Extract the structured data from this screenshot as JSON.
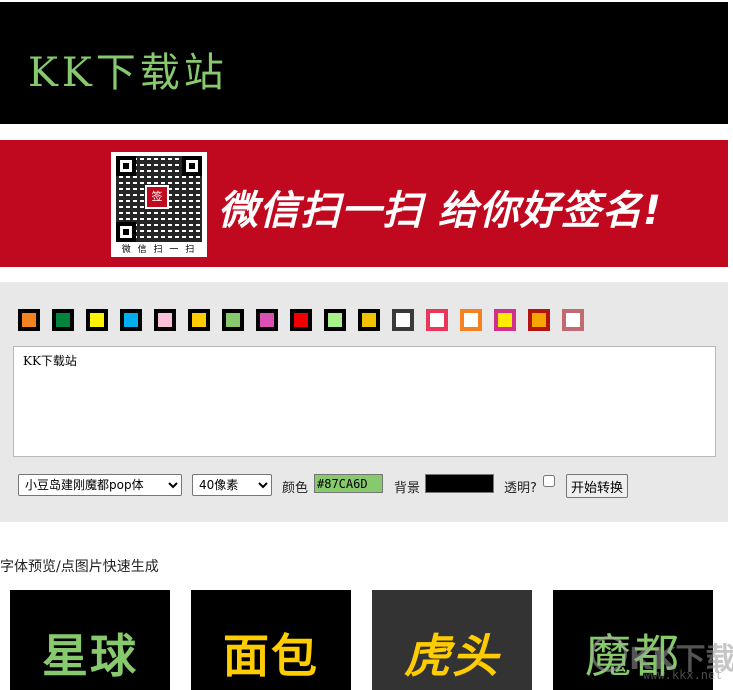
{
  "preview": {
    "text": "KK下载站",
    "color": "#87CA6D",
    "background": "#000000"
  },
  "promo": {
    "qr_caption": "微 信 扫 一 扫",
    "qr_center_char": "签",
    "slogan": "微信扫一扫  给你好签名!",
    "background": "#C0081E"
  },
  "swatches": [
    {
      "color": "#F58220"
    },
    {
      "color": "#00843D"
    },
    {
      "color": "#FFF200"
    },
    {
      "color": "#00AEEF"
    },
    {
      "color": "#F9C0D8"
    },
    {
      "color": "#FFCC00"
    },
    {
      "color": "#87CA6D"
    },
    {
      "color": "#D94FB4"
    },
    {
      "color": "#EE0000"
    },
    {
      "color": "#A8F08A"
    },
    {
      "color": "#F2C200"
    },
    {
      "color": "#FFFFFF",
      "border": "#3A3A3A"
    },
    {
      "color": "#FFFFFF",
      "border": "#E8375A"
    },
    {
      "color": "#FFFFFF",
      "border": "#F58220"
    },
    {
      "color": "#FFEA00",
      "border": "#D1308A"
    },
    {
      "color": "#F7A600",
      "border": "#B4140E"
    },
    {
      "color": "#FFFFFF",
      "border": "#C26A72"
    }
  ],
  "editor": {
    "text": "KK下载站"
  },
  "controls": {
    "font_selected": "小豆岛建刚魔都pop体",
    "size_selected": "40像素",
    "color_label": "颜色",
    "color_value": "#87CA6D",
    "bg_label": "背景",
    "bg_value": "#000000",
    "transparent_label": "透明?",
    "submit_label": "开始转换"
  },
  "gallery": {
    "title": "字体预览/点图片快速生成",
    "items": [
      {
        "text": "星球",
        "color": "#87CA6D",
        "background": "#000000"
      },
      {
        "text": "面包",
        "color": "#FFCC00",
        "background": "#000000"
      },
      {
        "text": "虎头",
        "color": "#FFCC00",
        "background": "#333333"
      },
      {
        "text": "魔都",
        "color": "#87CA6D",
        "background": "#000000"
      }
    ]
  },
  "watermark": {
    "text": "KK下载",
    "url": "www.kkx.net"
  }
}
